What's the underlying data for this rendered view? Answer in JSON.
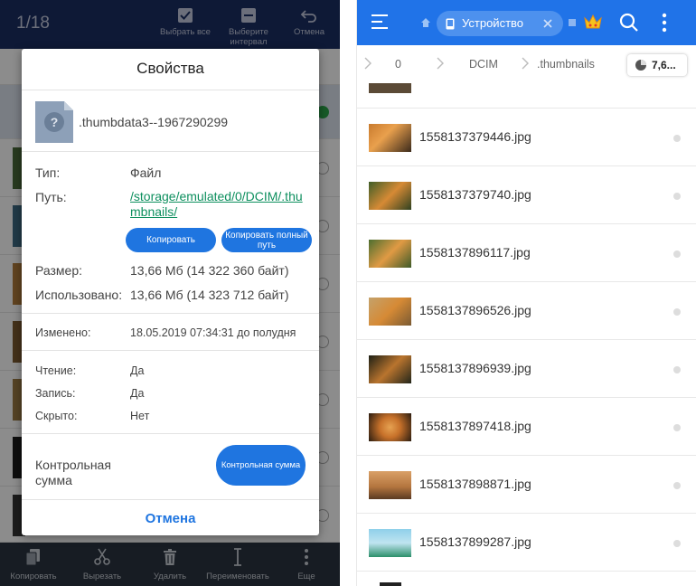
{
  "left_panel": {
    "counter": "1/18",
    "top_actions": [
      {
        "label": "Выбрать все",
        "icon": "checkbox-icon"
      },
      {
        "label": "Выберите интервал",
        "icon": "interval-icon"
      },
      {
        "label": "Отмена",
        "icon": "undo-icon"
      }
    ],
    "bottom_actions": [
      {
        "label": "Копировать",
        "icon": "copy-icon"
      },
      {
        "label": "Вырезать",
        "icon": "scissors-icon"
      },
      {
        "label": "Удалить",
        "icon": "trash-icon"
      },
      {
        "label": "Переименовать",
        "icon": "rename-icon"
      },
      {
        "label": "Еще",
        "icon": "more-vertical-icon"
      }
    ]
  },
  "dialog": {
    "title": "Свойства",
    "file_name": ".thumbdata3--1967290299",
    "type_label": "Тип:",
    "type_value": "Файл",
    "path_label": "Путь:",
    "path_value": "/storage/emulated/0/DCIM/.thumbnails/",
    "copy_button": "Копировать",
    "copy_full_path_button": "Копировать полный путь",
    "size_label": "Размер:",
    "size_value": "13,66 Мб (14 322 360 байт)",
    "used_label": "Использовано:",
    "used_value": "13,66 Мб (14 323 712 байт)",
    "modified_label": "Изменено:",
    "modified_value": "18.05.2019 07:34:31 до полудня",
    "read_label": "Чтение:",
    "read_value": "Да",
    "write_label": "Запись:",
    "write_value": "Да",
    "hidden_label": "Скрыто:",
    "hidden_value": "Нет",
    "checksum_label": "Контрольная сумма",
    "checksum_button": "Контрольная сумма",
    "cancel_button": "Отмена"
  },
  "right_panel": {
    "device_label": "Устройство",
    "breadcrumb": [
      "0",
      "DCIM",
      ".thumbnails"
    ],
    "storage_chip": "7,6...",
    "files": [
      {
        "name": "1558137379446.jpg"
      },
      {
        "name": "1558137379740.jpg"
      },
      {
        "name": "1558137896117.jpg"
      },
      {
        "name": "1558137896526.jpg"
      },
      {
        "name": "1558137896939.jpg"
      },
      {
        "name": "1558137897418.jpg"
      },
      {
        "name": "1558137898871.jpg"
      },
      {
        "name": "1558137899287.jpg"
      }
    ]
  },
  "colors": {
    "accent": "#1f75e0",
    "top_bar_right": "#2073e8",
    "top_bar_left": "#1b2f63",
    "link": "#0d8f5e"
  }
}
